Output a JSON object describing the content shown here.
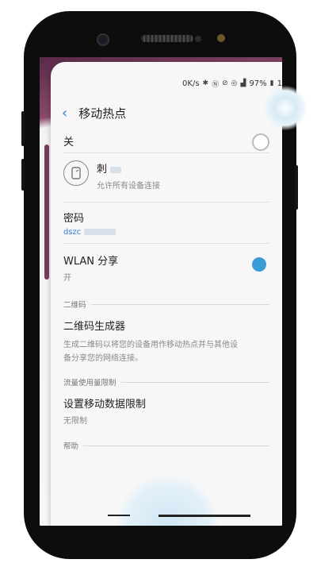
{
  "statusbar": {
    "net_speed": "0K/s",
    "battery": "97%",
    "extra": "1"
  },
  "header": {
    "title": "移动热点"
  },
  "hotspot": {
    "state_label": "关"
  },
  "device": {
    "name": "刺",
    "subtitle": "允许所有设备连接"
  },
  "password": {
    "label": "密码",
    "value": "dszc"
  },
  "wlan_share": {
    "label": "WLAN 分享",
    "state": "开"
  },
  "qr": {
    "section": "二维码",
    "title": "二维码生成器",
    "desc_line1": "生成二维码以将您的设备用作移动热点并与其他设",
    "desc_line2": "备分享您的网络连接。"
  },
  "data_limit": {
    "section": "流量使用量限制",
    "title": "设置移动数据限制",
    "value": "无限制"
  },
  "help": {
    "section": "帮助"
  },
  "colors": {
    "accent": "#3a7bd5",
    "toggle_on": "#3a9bd5"
  }
}
